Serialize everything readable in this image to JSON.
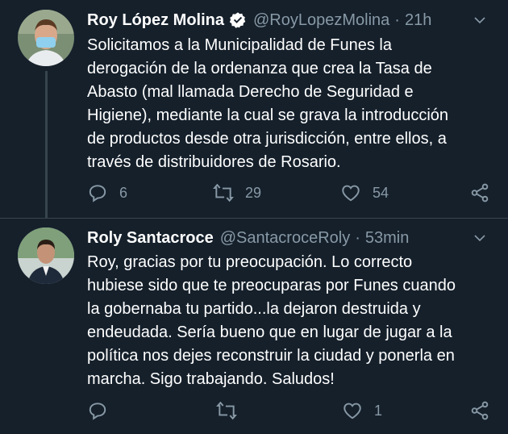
{
  "tweets": [
    {
      "author_name": "Roy López Molina",
      "verified": true,
      "handle": "@RoyLopezMolina",
      "separator": "·",
      "time": "21h",
      "text": "Solicitamos a la Municipalidad de Funes la\nderogación de la ordenanza que crea la Tasa de\nAbasto (mal llamada Derecho de Seguridad e\nHigiene), mediante la cual se grava la introducción\nde productos desde otra jurisdicción, entre ellos, a\ntravés de distribuidores de Rosario.",
      "reply_count": "6",
      "retweet_count": "29",
      "like_count": "54"
    },
    {
      "author_name": "Roly Santacroce",
      "verified": false,
      "handle": "@SantacroceRoly",
      "separator": "·",
      "time": "53min",
      "text": "Roy, gracias por tu preocupación. Lo correcto\nhubiese sido que te preocuparas por Funes cuando\nla gobernaba tu partido...la dejaron destruida y\nendeudada. Sería bueno que en lugar de jugar a la\npolítica nos dejes reconstruir la ciudad y ponerla en\nmarcha. Sigo trabajando. Saludos!",
      "reply_count": "",
      "retweet_count": "",
      "like_count": "1"
    }
  ],
  "icons": {
    "reply": "reply-icon",
    "retweet": "retweet-icon",
    "like": "heart-icon",
    "share": "share-icon",
    "more": "chevron-down-icon",
    "verified": "verified-badge-icon"
  },
  "colors": {
    "background": "#15202b",
    "secondary_text": "#8899a6",
    "divider": "#38444d"
  }
}
